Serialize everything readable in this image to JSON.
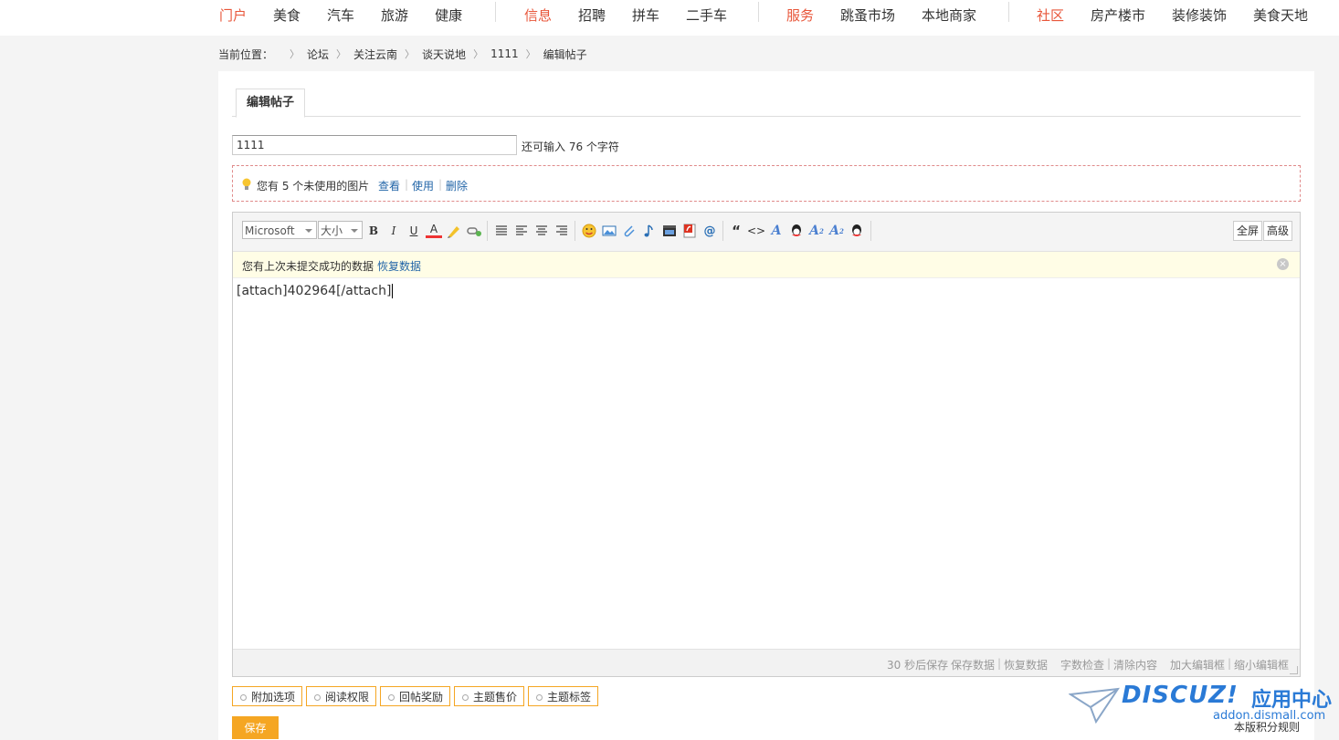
{
  "topnav": {
    "groups": [
      {
        "highlight": "门户",
        "items": [
          "美食",
          "汽车",
          "旅游",
          "健康"
        ]
      },
      {
        "highlight": "信息",
        "items": [
          "招聘",
          "拼车",
          "二手车"
        ]
      },
      {
        "highlight": "服务",
        "items": [
          "跳蚤市场",
          "本地商家"
        ]
      },
      {
        "highlight": "社区",
        "items": [
          "房产楼市",
          "装修装饰",
          "美食天地"
        ]
      }
    ]
  },
  "breadcrumb": {
    "label": "当前位置：",
    "items": [
      "论坛",
      "关注云南",
      "谈天说地",
      "1111",
      "编辑帖子"
    ]
  },
  "tab": {
    "label": "编辑帖子"
  },
  "subject": {
    "value": "1111",
    "count_text": "还可输入 76 个字符"
  },
  "unused": {
    "text": "您有 5 个未使用的图片",
    "view": "查看",
    "use": "使用",
    "delete": "删除"
  },
  "toolbar": {
    "font_value": "Microsoft",
    "size_value": "大小",
    "fullscreen": "全屏",
    "advanced": "高级"
  },
  "restore": {
    "text": "您有上次未提交成功的数据",
    "link": "恢复数据"
  },
  "editor": {
    "content": "[attach]402964[/attach]"
  },
  "statusbar": {
    "autosave": "30 秒后保存",
    "save_data": "保存数据",
    "restore_data": "恢复数据",
    "word_check": "字数检查",
    "clear": "清除内容",
    "enlarge": "加大编辑框",
    "shrink": "缩小编辑框"
  },
  "options": [
    "附加选项",
    "阅读权限",
    "回帖奖励",
    "主题售价",
    "主题标签"
  ],
  "save_label": "保存",
  "rules_label": "本版积分规则",
  "watermark": {
    "logo": "DISCUZ!",
    "zh": "应用中心",
    "url": "addon.dismall.com"
  },
  "colors": {
    "accent": "#f5a623",
    "nav_highlight": "#e8563a",
    "link": "#2366a8"
  }
}
